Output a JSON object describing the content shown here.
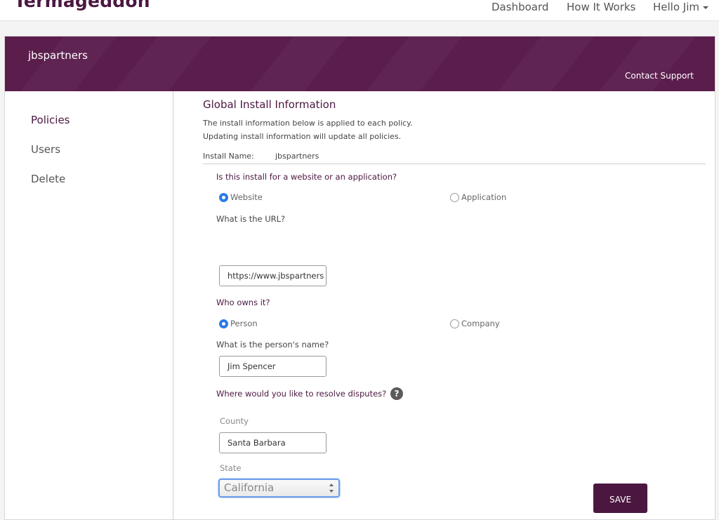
{
  "nav": {
    "logo": "Termageddon",
    "links": {
      "dashboard": "Dashboard",
      "how_it_works": "How It Works",
      "user": "Hello Jim"
    }
  },
  "banner": {
    "account_name": "jbspartners",
    "contact_support": "Contact Support"
  },
  "sidebar": {
    "items": [
      {
        "label": "Policies",
        "active": true
      },
      {
        "label": "Users",
        "active": false
      },
      {
        "label": "Delete",
        "active": false
      }
    ]
  },
  "main": {
    "title": "Global Install Information",
    "desc_line1": "The install information below is applied to each policy.",
    "desc_line2": "Updating install information will update all policies.",
    "install_name_label": "Install Name:",
    "install_name_value": "jbspartners",
    "q_type": "Is this install for a website or an application?",
    "opt_website": "Website",
    "opt_application": "Application",
    "q_url": "What is the URL?",
    "url_value": "https://www.jbspartners",
    "q_owner": "Who owns it?",
    "opt_person": "Person",
    "opt_company": "Company",
    "q_person_name": "What is the person's name?",
    "person_name_value": "Jim Spencer",
    "q_disputes": "Where would you like to resolve disputes?",
    "help_glyph": "?",
    "county_label": "County",
    "county_value": "Santa Barbara",
    "state_label": "State",
    "state_value": "California",
    "save_label": "SAVE"
  },
  "colors": {
    "brand": "#4b1740",
    "radio_checked": "#2d7be5"
  }
}
